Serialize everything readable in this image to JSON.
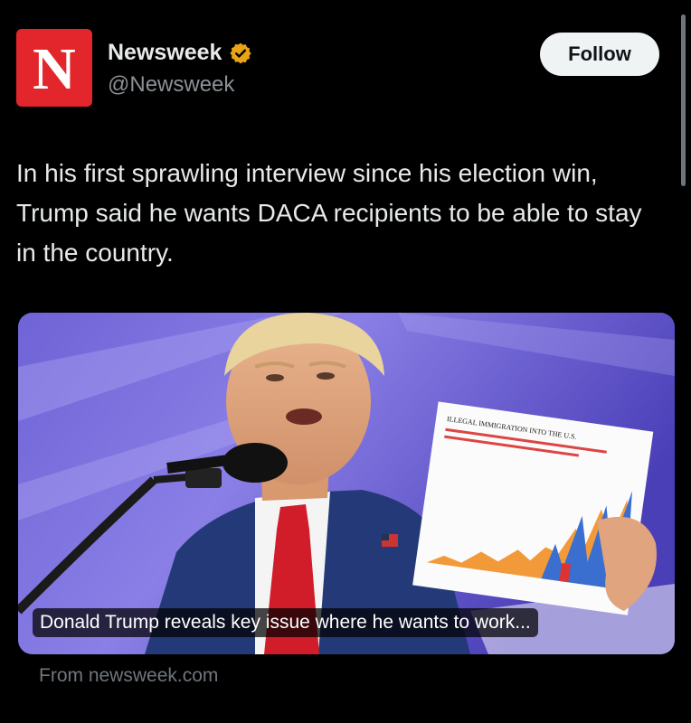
{
  "account": {
    "avatar_letter": "N",
    "display_name": "Newsweek",
    "handle": "@Newsweek",
    "verified_badge_color": "#e8a317",
    "avatar_color": "#e3262b"
  },
  "follow_label": "Follow",
  "tweet": {
    "text": "In his first sprawling interview since his election win, Trump said he wants DACA recipients to be able to stay in the country."
  },
  "link_card": {
    "headline": "Donald Trump reveals key issue where he wants to work...",
    "source": "From newsweek.com",
    "chart_title": "ILLEGAL IMMIGRATION INTO THE U.S."
  }
}
